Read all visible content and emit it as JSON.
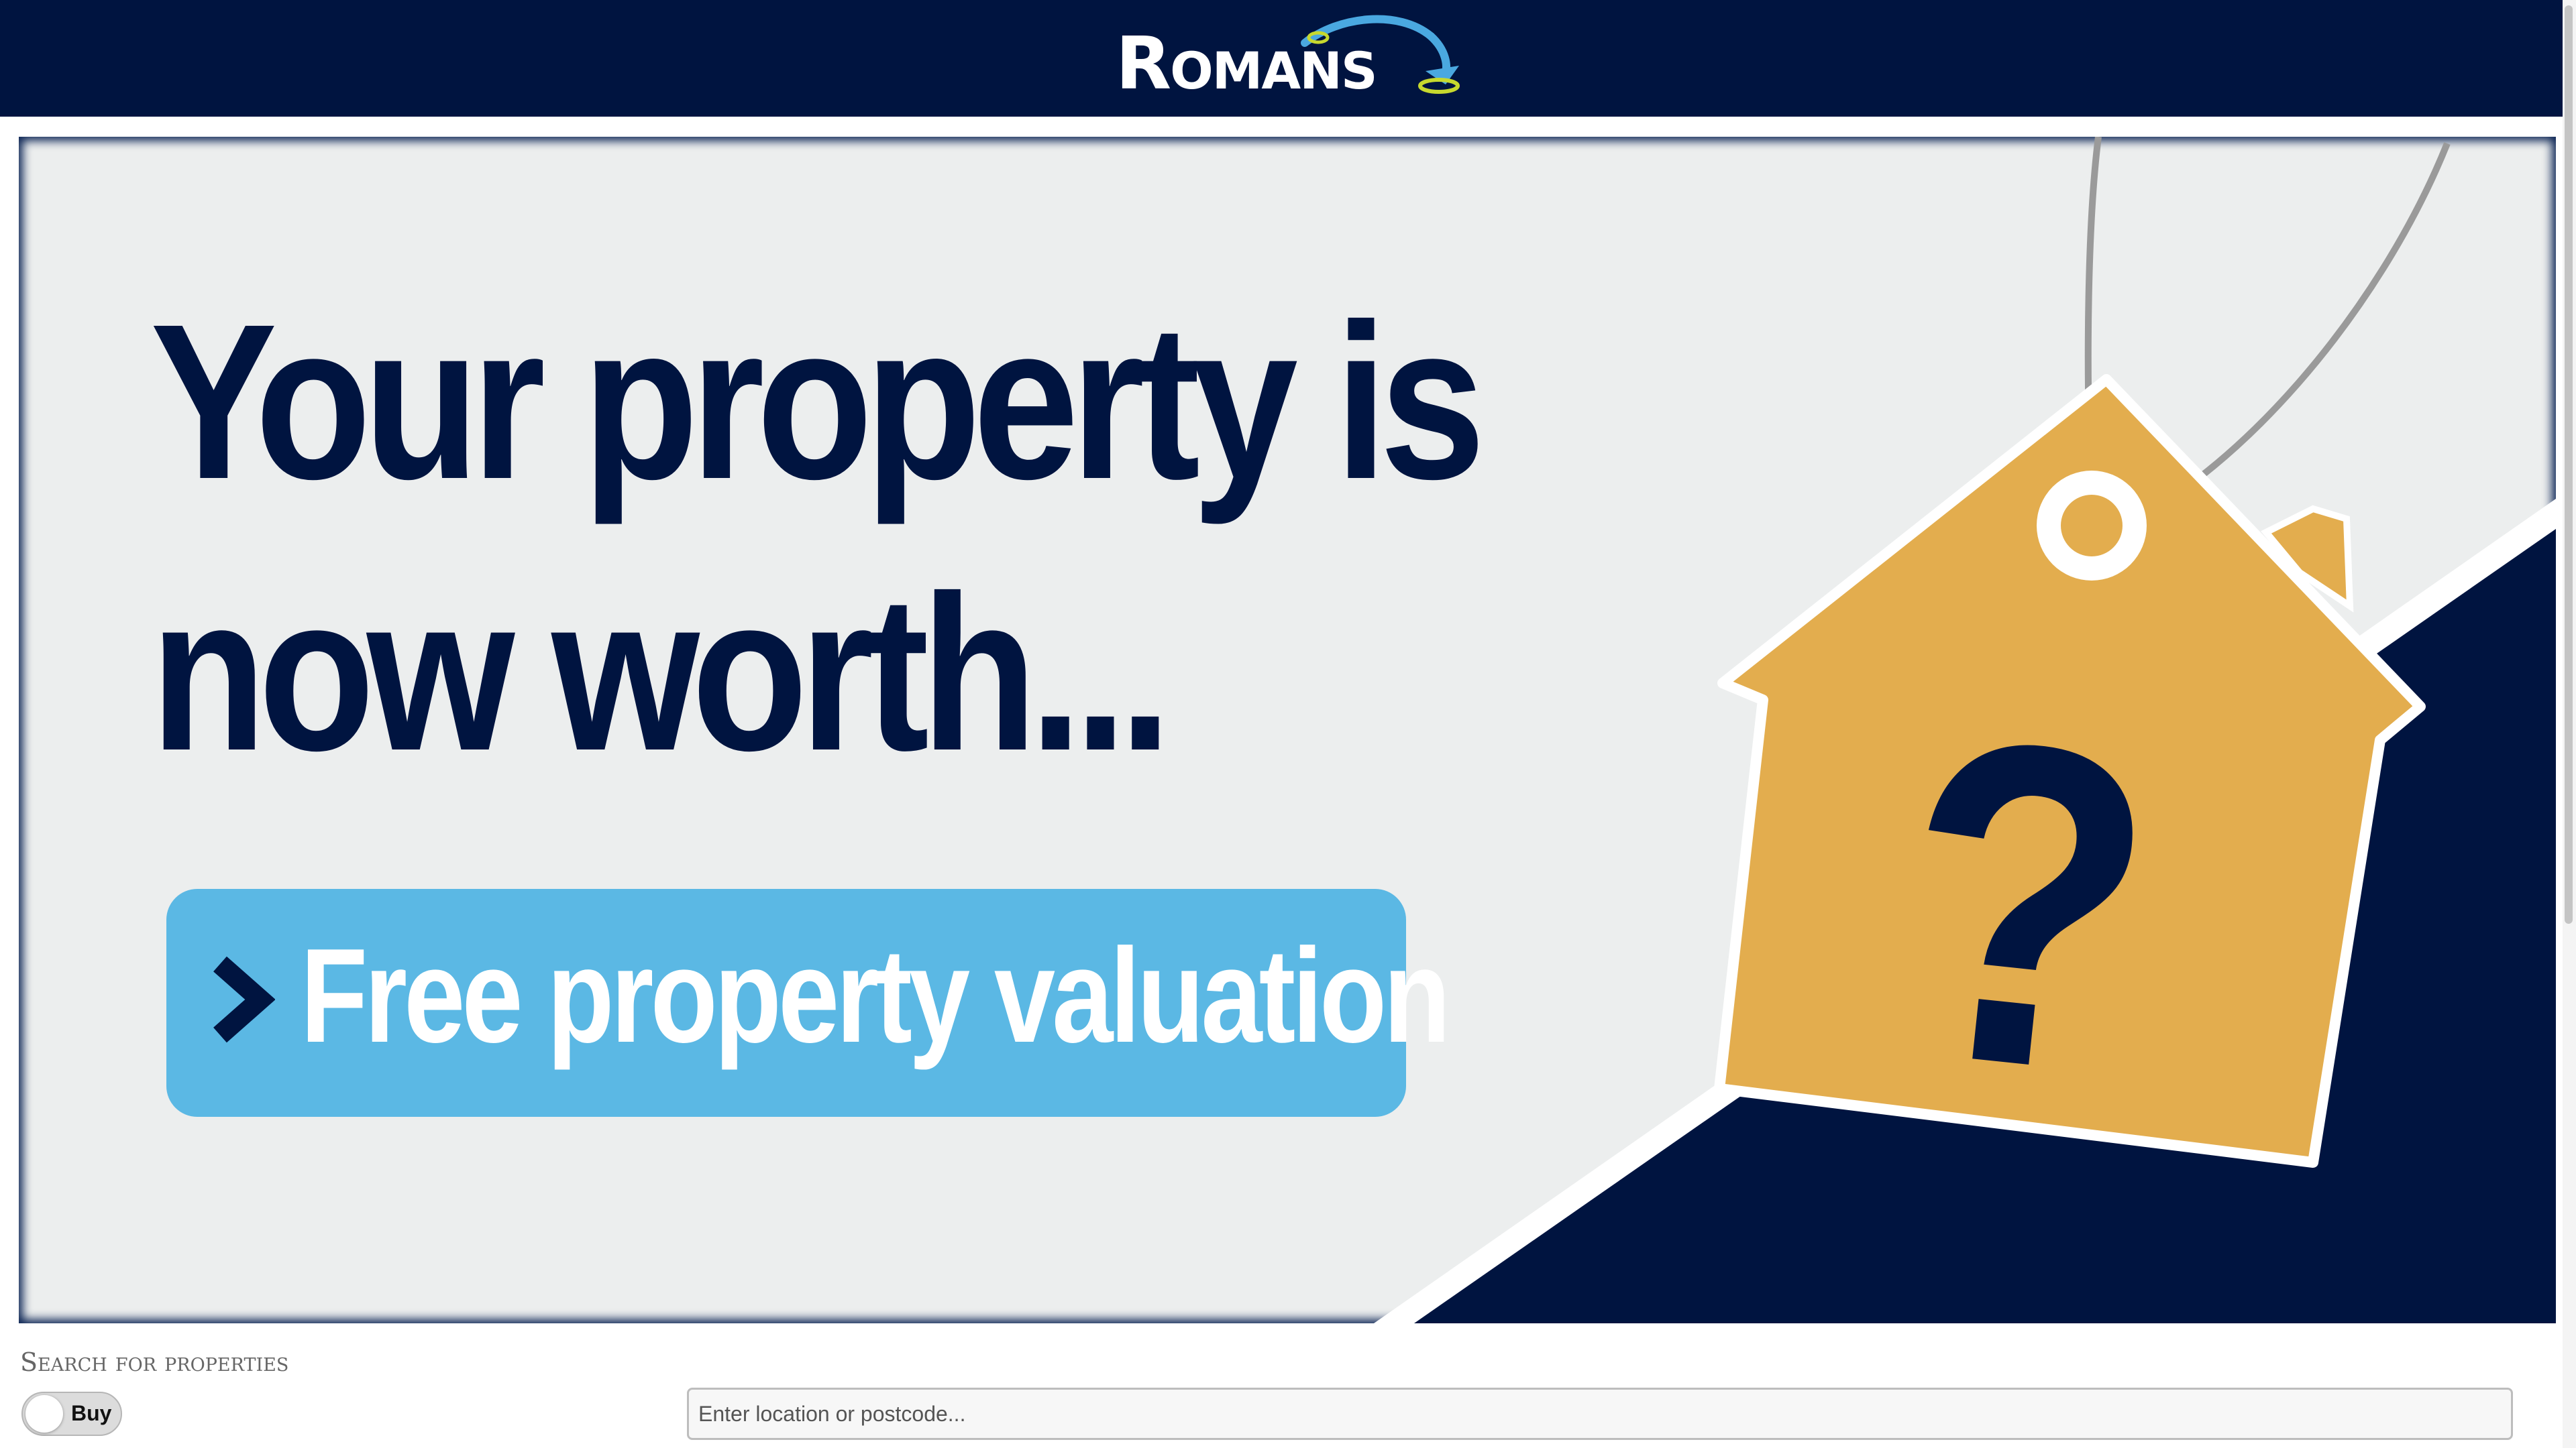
{
  "header": {
    "logo_text": "Romans"
  },
  "banner": {
    "headline_line1": "Your property is",
    "headline_line2": "now worth...",
    "cta_label": "Free property valuation",
    "tag_symbol": "?",
    "colors": {
      "navy": "#001440",
      "cta_blue": "#5bb8e4",
      "tag_gold": "#e3ad4e",
      "background": "#eceeee"
    }
  },
  "search": {
    "section_title": "Search for properties",
    "toggle_label": "Buy",
    "input_placeholder": "Enter location or postcode..."
  },
  "icons": {
    "cta_icon": "chevron-right-icon",
    "logo_icon": "swoosh-arrow-icon"
  }
}
